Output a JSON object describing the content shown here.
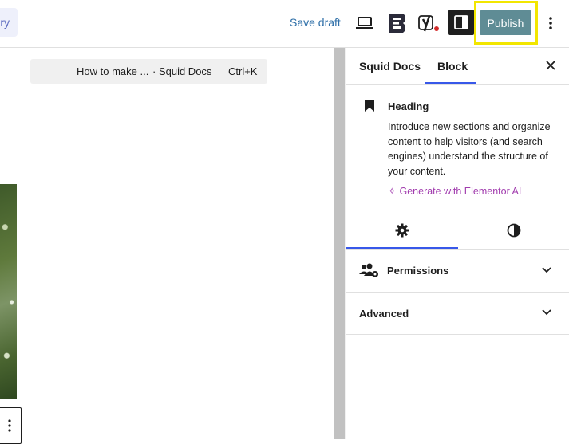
{
  "topbar": {
    "gallery_partial": "ry",
    "save_draft": "Save draft",
    "publish": "Publish",
    "icons": {
      "preview": "laptop-icon",
      "essential_blocks": "eb-icon",
      "yoast": "yoast-icon",
      "settings": "sidebar-toggle-icon",
      "options": "more-vertical-icon"
    },
    "colors": {
      "publish_bg": "#5f8c95",
      "highlight": "#f2e600",
      "link": "#2e6fa8"
    }
  },
  "command_bar": {
    "title": "How to make ...",
    "site": "· Squid Docs",
    "shortcut": "Ctrl+K"
  },
  "sidebar": {
    "tabs": [
      {
        "label": "Squid Docs"
      },
      {
        "label": "Block"
      }
    ],
    "active_tab": "Block",
    "block": {
      "name": "Heading",
      "description": "Introduce new sections and organize content to help visitors (and search engines) understand the structure of your content.",
      "generate_ai": "Generate with Elementor AI"
    },
    "panels": {
      "permissions": "Permissions",
      "advanced": "Advanced"
    },
    "colors": {
      "accent": "#3858e9",
      "ai": "#a13cae"
    }
  }
}
